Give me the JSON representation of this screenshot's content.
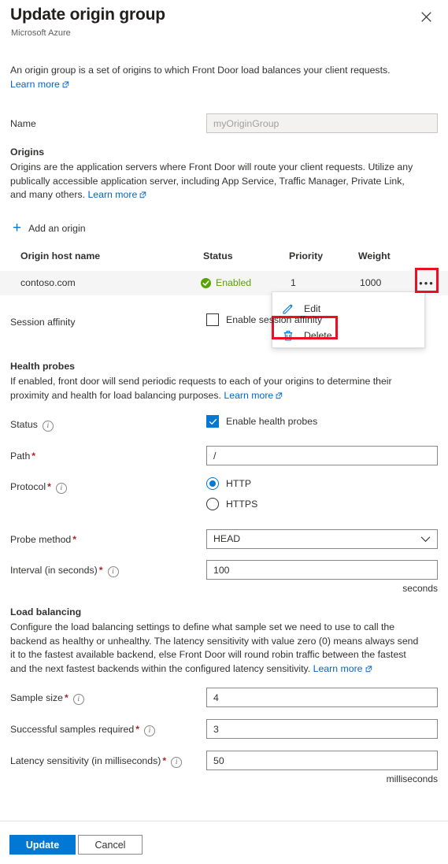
{
  "header": {
    "title": "Update origin group",
    "subtitle": "Microsoft Azure",
    "close_icon": "close-icon"
  },
  "intro": {
    "text": "An origin group is a set of origins to which Front Door load balances your client requests.",
    "learn_more": "Learn more"
  },
  "name_field": {
    "label": "Name",
    "value": "myOriginGroup",
    "disabled": true
  },
  "origins": {
    "heading": "Origins",
    "description": "Origins are the application servers where Front Door will route your client requests. Utilize any publically accessible application server, including App Service, Traffic Manager, Private Link, and many others.",
    "learn_more": "Learn more",
    "add_label": "Add an origin",
    "add_icon": "plus-icon",
    "columns": [
      "Origin host name",
      "Status",
      "Priority",
      "Weight"
    ],
    "rows": [
      {
        "host": "contoso.com",
        "status": "Enabled",
        "status_icon": "check-circle-icon",
        "priority": "1",
        "weight": "1000",
        "overflow_icon": "ellipsis-icon"
      }
    ]
  },
  "context_menu": {
    "items": [
      {
        "label": "Edit",
        "icon": "pencil-icon",
        "highlighted": false
      },
      {
        "label": "Delete",
        "icon": "trash-icon",
        "highlighted": true
      }
    ]
  },
  "session_affinity": {
    "label": "Session affinity",
    "checkbox_label": "Enable session affinity",
    "checked": false
  },
  "health_probes": {
    "heading": "Health probes",
    "description": "If enabled, front door will send periodic requests to each of your origins to determine their proximity and health for load balancing purposes.",
    "learn_more": "Learn more",
    "status": {
      "label": "Status",
      "checkbox_label": "Enable health probes",
      "checked": true
    },
    "path": {
      "label": "Path",
      "required": true,
      "value": "/"
    },
    "protocol": {
      "label": "Protocol",
      "required": true,
      "options": [
        "HTTP",
        "HTTPS"
      ],
      "selected": "HTTP"
    },
    "probe_method": {
      "label": "Probe method",
      "required": true,
      "value": "HEAD",
      "chevron_icon": "chevron-down-icon"
    },
    "interval": {
      "label": "Interval (in seconds)",
      "required": true,
      "value": "100",
      "suffix": "seconds"
    }
  },
  "load_balancing": {
    "heading": "Load balancing",
    "description": "Configure the load balancing settings to define what sample set we need to use to call the backend as healthy or unhealthy. The latency sensitivity with value zero (0) means always send it to the fastest available backend, else Front Door will round robin traffic between the fastest and the next fastest backends within the configured latency sensitivity.",
    "learn_more": "Learn more",
    "sample_size": {
      "label": "Sample size",
      "required": true,
      "value": "4"
    },
    "successful_samples": {
      "label": "Successful samples required",
      "required": true,
      "value": "3"
    },
    "latency_sensitivity": {
      "label": "Latency sensitivity (in milliseconds)",
      "required": true,
      "value": "50",
      "suffix": "milliseconds"
    }
  },
  "footer": {
    "update_label": "Update",
    "cancel_label": "Cancel"
  },
  "colors": {
    "accent": "#0078d4",
    "link": "#0066cc",
    "required": "#a4262c",
    "status_green": "#57a300",
    "highlight_red": "#e81123",
    "row_bg": "#f5f5f5"
  }
}
